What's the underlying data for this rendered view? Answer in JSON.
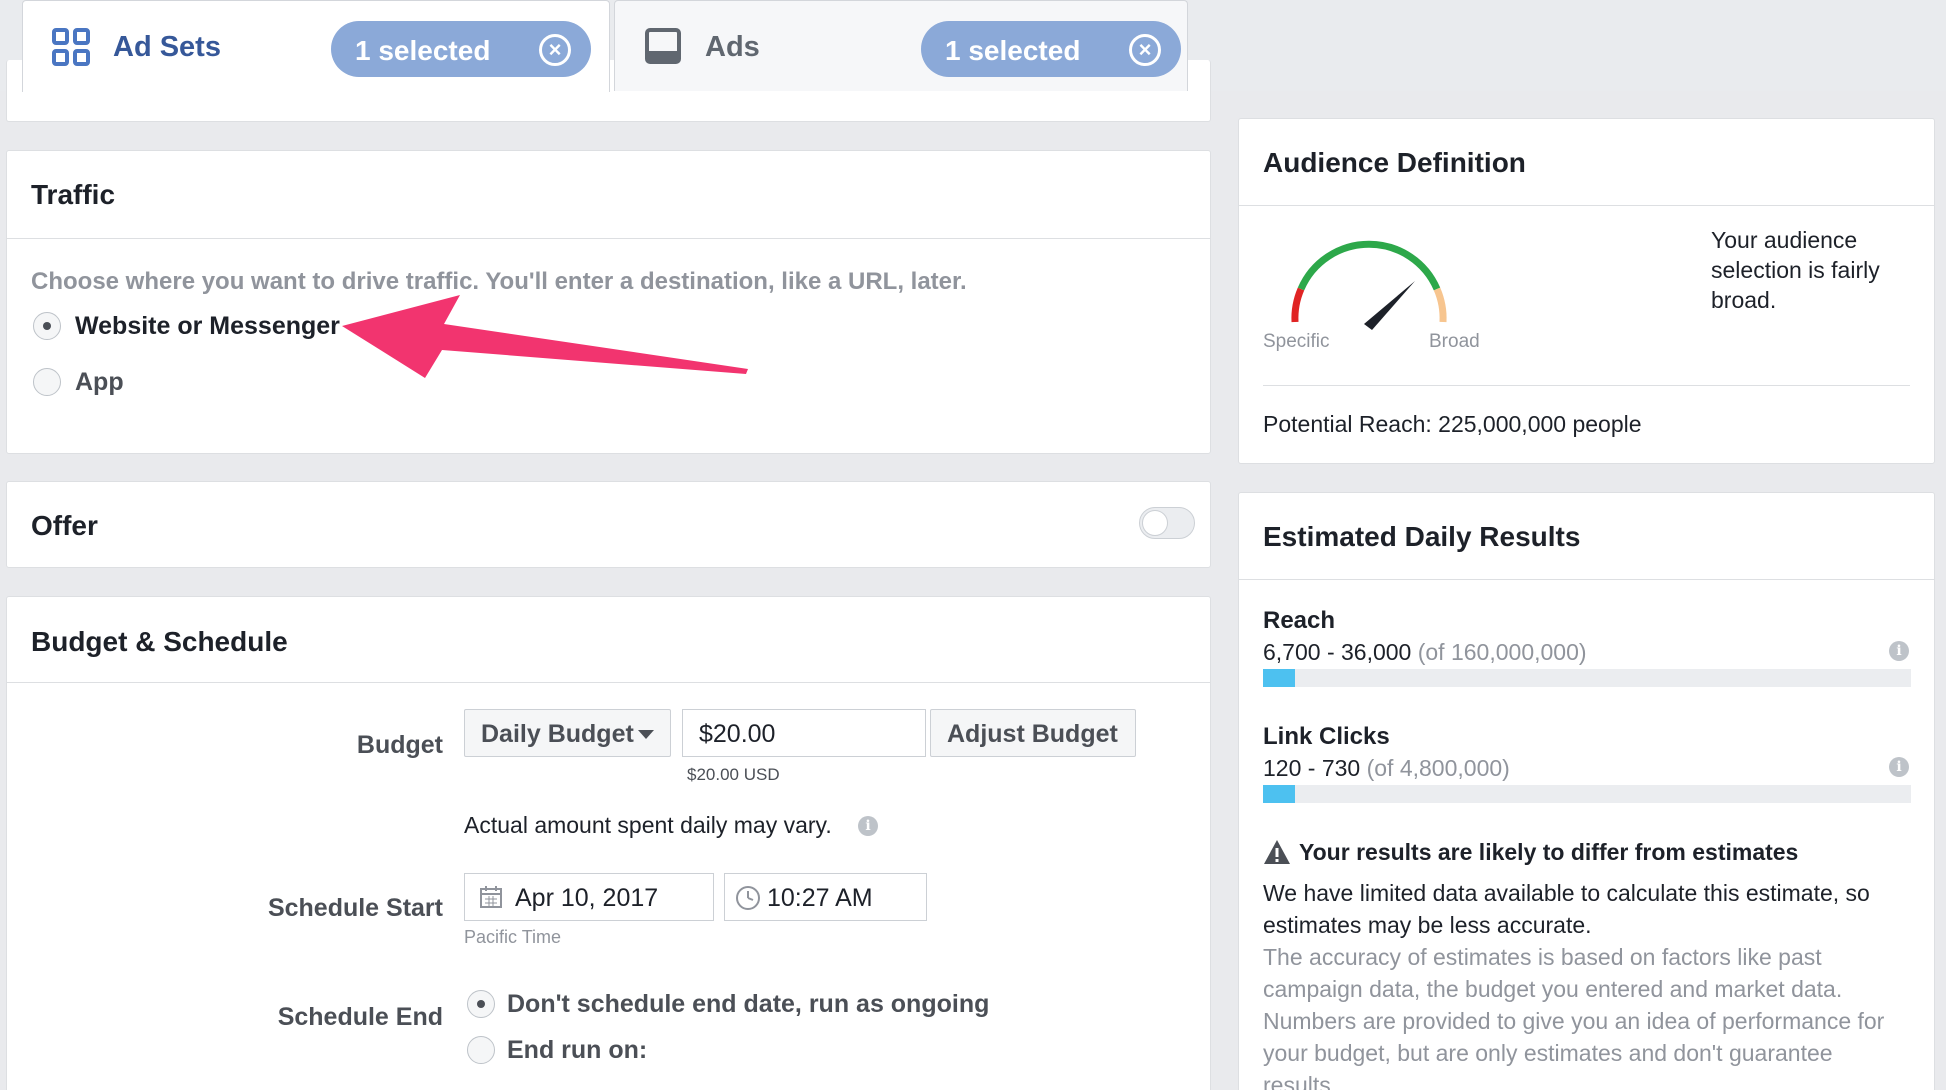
{
  "tabs": [
    {
      "label": "Ad Sets",
      "selected_label": "1 selected",
      "icon": "grid-icon"
    },
    {
      "label": "Ads",
      "selected_label": "1 selected",
      "icon": "ad-preview-icon"
    }
  ],
  "traffic": {
    "title": "Traffic",
    "description": "Choose where you want to drive traffic. You'll enter a destination, like a URL, later.",
    "options": [
      {
        "label": "Website or Messenger",
        "checked": true
      },
      {
        "label": "App",
        "checked": false
      }
    ]
  },
  "offer": {
    "title": "Offer",
    "toggle_on": false
  },
  "budget_schedule": {
    "title": "Budget & Schedule",
    "budget_label": "Budget",
    "budget_type": "Daily Budget",
    "budget_value": "$20.00",
    "budget_currency_note": "$20.00 USD",
    "adjust_label": "Adjust Budget",
    "vary_note": "Actual amount spent daily may vary.",
    "schedule_start_label": "Schedule Start",
    "start_date": "Apr 10, 2017",
    "start_time": "10:27 AM",
    "timezone": "Pacific Time",
    "schedule_end_label": "Schedule End",
    "end_options": [
      {
        "label": "Don't schedule end date, run as ongoing",
        "checked": true
      },
      {
        "label": "End run on:",
        "checked": false
      }
    ]
  },
  "audience": {
    "title": "Audience Definition",
    "gauge_left": "Specific",
    "gauge_right": "Broad",
    "description": "Your audience selection is fairly broad.",
    "potential_reach": "Potential Reach: 225,000,000 people"
  },
  "estimates": {
    "title": "Estimated Daily Results",
    "metrics": [
      {
        "name": "Reach",
        "range": "6,700 - 36,000",
        "of": "(of 160,000,000)",
        "fill_fraction": 0.05
      },
      {
        "name": "Link Clicks",
        "range": "120 - 730",
        "of": "(of 4,800,000)",
        "fill_fraction": 0.05
      }
    ],
    "warning_title": "Your results are likely to differ from estimates",
    "warning_body": "We have limited data available to calculate this estimate, so estimates may be less accurate.",
    "disclaimer": "The accuracy of estimates is based on factors like past campaign data, the budget you entered and market data. Numbers are provided to give you an idea of performance for your budget, but are only estimates and don't guarantee results."
  },
  "colors": {
    "accent": "#365899",
    "pill": "#8ba9d8",
    "annotation_arrow": "#f2346f",
    "bar_fill": "#4dc1f0"
  }
}
